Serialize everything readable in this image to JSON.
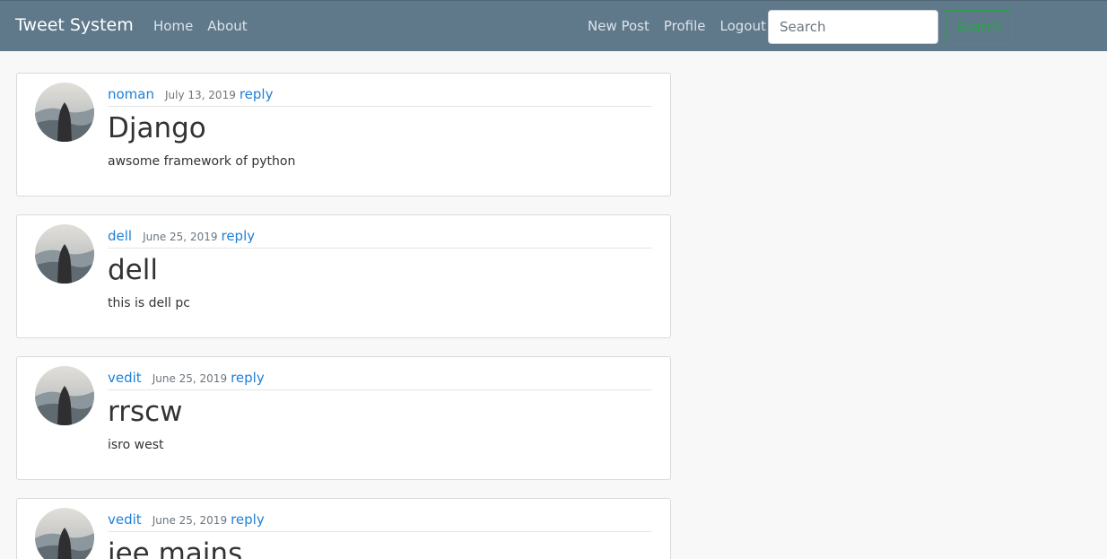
{
  "navbar": {
    "brand": "Tweet System",
    "links_left": [
      "Home",
      "About"
    ],
    "links_right": [
      "New Post",
      "Profile",
      "Logout"
    ],
    "search_placeholder": "Search",
    "search_button": "Search",
    "background_color": "#5f788a",
    "search_button_color": "#28a745"
  },
  "posts": [
    {
      "author": "noman",
      "date": "July 13, 2019",
      "reply_label": "reply",
      "title": "Django",
      "body": "awsome framework of python"
    },
    {
      "author": "dell",
      "date": "June 25, 2019",
      "reply_label": "reply",
      "title": "dell",
      "body": "this is dell pc"
    },
    {
      "author": "vedit",
      "date": "June 25, 2019",
      "reply_label": "reply",
      "title": "rrscw",
      "body": "isro west"
    },
    {
      "author": "vedit",
      "date": "June 25, 2019",
      "reply_label": "reply",
      "title": "jee mains",
      "body": ""
    }
  ],
  "colors": {
    "link": "#1f80d8",
    "page_background": "#f8f8f8"
  }
}
